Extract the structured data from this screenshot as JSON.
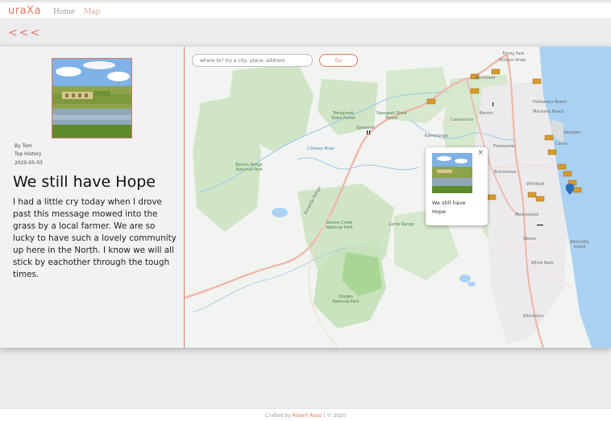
{
  "app": {
    "logo": "uraXa"
  },
  "nav": {
    "home": "Home",
    "map": "Map"
  },
  "back_label": "<<<",
  "post": {
    "author": "By Tom",
    "category": "Top History",
    "date": "2020-05-03",
    "title": "We still have Hope",
    "body": "I had a little cry today when I drove past this message mowed into the grass by a local farmer. We are so lucky to have such a lovely community up here in the North. I know we will all stick by eachother through the tough times."
  },
  "map": {
    "search_placeholder": "where to? try a city, place, address",
    "go_label": "Go",
    "popup": {
      "close": "×",
      "text": "We still have Hope"
    },
    "labels": {
      "kuranda": "Kuranda Range",
      "clohesy": "Clohesy River",
      "tomahawk": "Tomahawk Creek",
      "water": "Lake",
      "trinity_park": "Trinity Park",
      "yorkeys": "Yorkeys Knob",
      "smithfield": "Smithfield",
      "holloways": "Holloways Beach",
      "machans": "Machans Beach",
      "caravonica": "Caravonica",
      "barron": "Barron",
      "kamerunga": "Kamerunga",
      "freshwater": "Freshwater",
      "redlynch": "Redlynch",
      "brinsmead": "Brinsmead",
      "whitfield": "Whitfield",
      "aeroglen": "Aeroglen",
      "cairns": "Cairns",
      "mooroobool": "Mooroobool",
      "woree": "Woree",
      "white_rock": "White Rock",
      "edmonton": "Edmonton",
      "bentley_park": "Bentley Park",
      "admiralty": "Admiralty Island",
      "speewah": "Speewah",
      "barron_gorge": "Barron Gorge National Park",
      "tomahawk_forest": "Tomahawk State Forest",
      "speewah_forest": "Speewah State Forest",
      "davies_forest": "Davies Creek National Park",
      "lamb_range": "Lamb Range",
      "dinden": "Dinden National Park"
    }
  },
  "footer": {
    "prefix": "Crafted by ",
    "author": "Robert Rossi",
    "suffix": " | © 2020"
  },
  "colors": {
    "accent": "#e07862"
  }
}
